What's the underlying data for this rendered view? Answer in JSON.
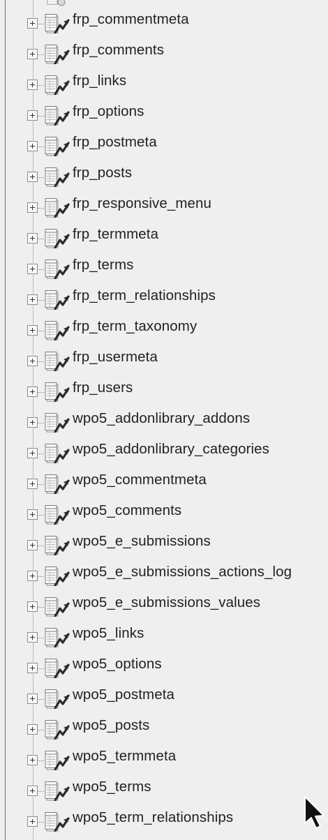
{
  "tree": {
    "items": [
      {
        "label": "frp_commentmeta"
      },
      {
        "label": "frp_comments"
      },
      {
        "label": "frp_links"
      },
      {
        "label": "frp_options"
      },
      {
        "label": "frp_postmeta"
      },
      {
        "label": "frp_posts"
      },
      {
        "label": "frp_responsive_menu"
      },
      {
        "label": "frp_termmeta"
      },
      {
        "label": "frp_terms"
      },
      {
        "label": "frp_term_relationships"
      },
      {
        "label": "frp_term_taxonomy"
      },
      {
        "label": "frp_usermeta"
      },
      {
        "label": "frp_users"
      },
      {
        "label": "wpo5_addonlibrary_addons"
      },
      {
        "label": "wpo5_addonlibrary_categories"
      },
      {
        "label": "wpo5_commentmeta"
      },
      {
        "label": "wpo5_comments"
      },
      {
        "label": "wpo5_e_submissions"
      },
      {
        "label": "wpo5_e_submissions_actions_log"
      },
      {
        "label": "wpo5_e_submissions_values"
      },
      {
        "label": "wpo5_links"
      },
      {
        "label": "wpo5_options"
      },
      {
        "label": "wpo5_postmeta"
      },
      {
        "label": "wpo5_posts"
      },
      {
        "label": "wpo5_termmeta"
      },
      {
        "label": "wpo5_terms"
      },
      {
        "label": "wpo5_term_relationships"
      }
    ]
  },
  "icons": {
    "expander": "plus-box-icon",
    "table": "table-structure-icon",
    "cursor": "mouse-pointer-icon"
  }
}
